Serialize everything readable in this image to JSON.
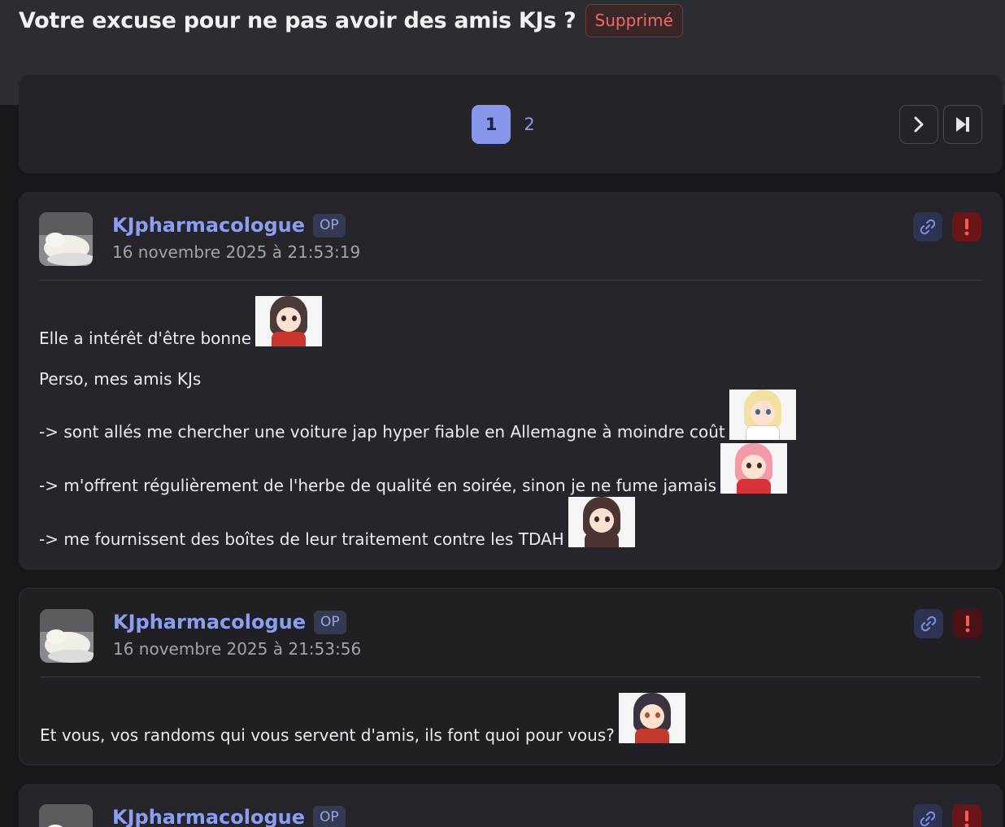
{
  "topic": {
    "title": "Votre excuse pour ne pas avoir des amis KJs ?",
    "status_badge": "Supprimé"
  },
  "pagination": {
    "pages": [
      "1",
      "2"
    ],
    "current_page": "1",
    "next_icon": "chevron-right-icon",
    "last_icon": "skip-to-last-icon"
  },
  "colors": {
    "accent": "#8796e8",
    "author": "#8d9df0",
    "report": "#6a1518",
    "deleted": "#ef6a6a"
  },
  "posts": [
    {
      "author": "KJpharmacologue",
      "badge": "OP",
      "date": "16 novembre 2025 à 21:53:19",
      "lines": [
        "Elle a intérêt d'être bonne",
        "Perso, mes amis KJs",
        "-> sont allés me chercher une voiture jap hyper fiable en Allemagne à moindre coût",
        "-> m'offrent régulièrement de l'herbe de qualité en soirée, sinon je ne fume jamais",
        "-> me fournissent des boîtes de leur traitement contre les TDAH"
      ]
    },
    {
      "author": "KJpharmacologue",
      "badge": "OP",
      "date": "16 novembre 2025 à 21:53:56",
      "lines": [
        "Et vous, vos randoms qui vous servent d'amis, ils font quoi pour vous?"
      ]
    },
    {
      "author": "KJpharmacologue",
      "badge": "OP"
    }
  ]
}
